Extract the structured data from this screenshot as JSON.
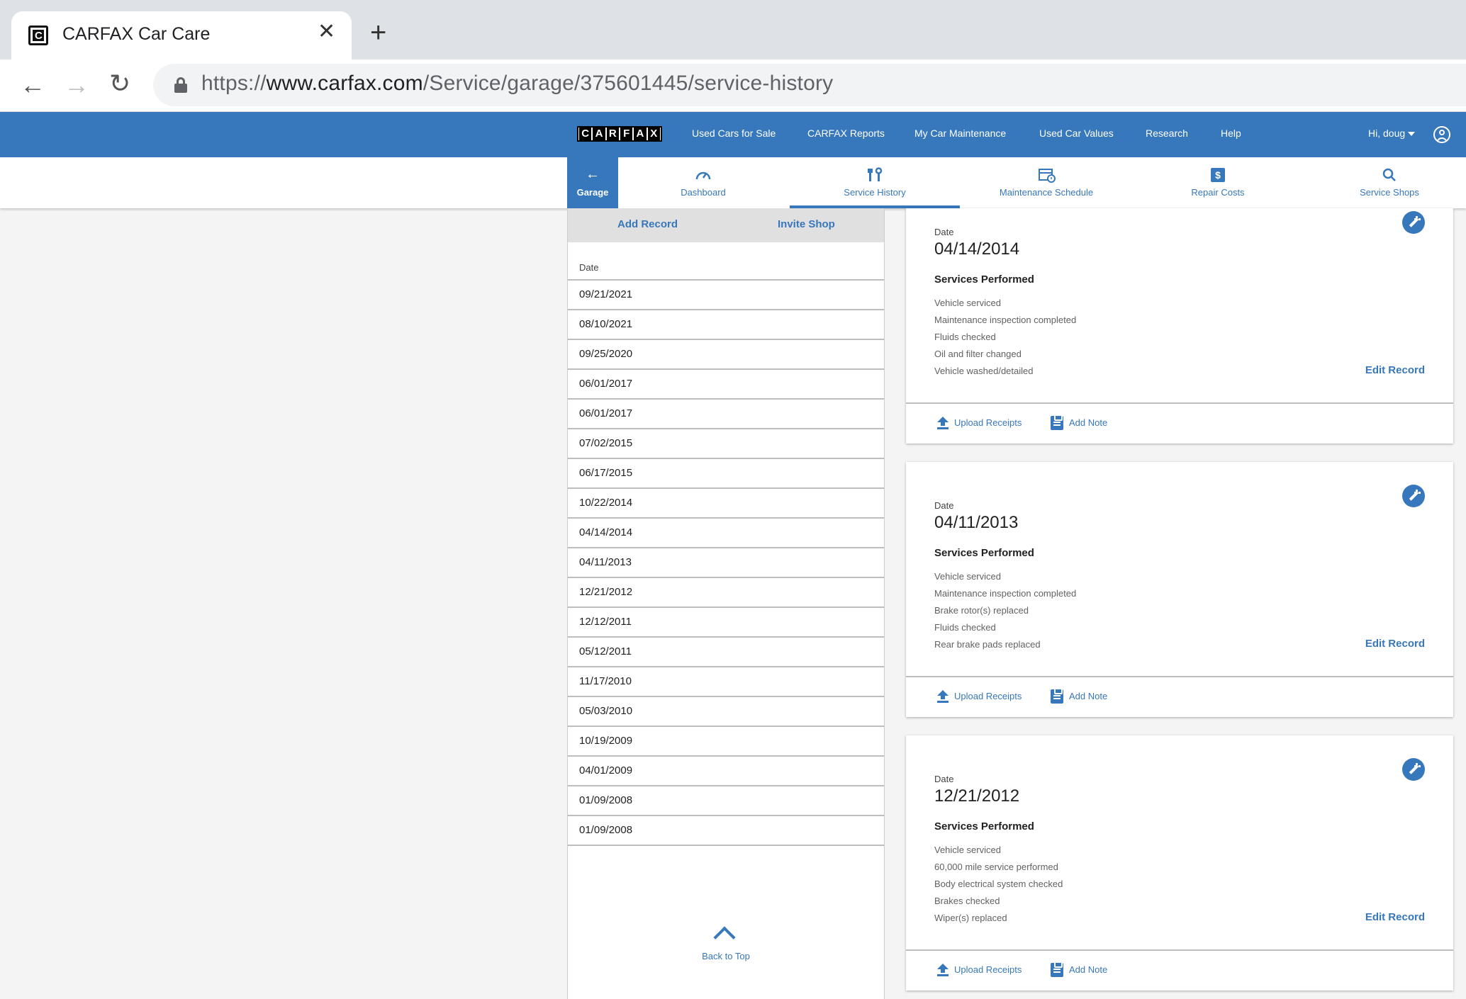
{
  "browser": {
    "tab_title": "CARFAX Car Care",
    "favicon_letter": "C",
    "url_prefix": "https://",
    "url_host": "www.carfax.com",
    "url_path": "/Service/garage/375601445/service-history"
  },
  "topnav": {
    "logo_letters": [
      "C",
      "A",
      "R",
      "F",
      "A",
      "X"
    ],
    "links": [
      "Used Cars for Sale",
      "CARFAX Reports",
      "My Car Maintenance",
      "Used Car Values",
      "Research",
      "Help"
    ],
    "user_greeting": "Hi, doug"
  },
  "subnav": {
    "back_label": "Garage",
    "tabs": [
      {
        "label": "Dashboard",
        "icon": "speedometer-icon"
      },
      {
        "label": "Service History",
        "icon": "wrench-icon",
        "active": true
      },
      {
        "label": "Maintenance Schedule",
        "icon": "calendar-icon"
      },
      {
        "label": "Repair Costs",
        "icon": "dollar-icon"
      },
      {
        "label": "Service Shops",
        "icon": "search-icon"
      }
    ]
  },
  "left_panel": {
    "add_record": "Add Record",
    "invite_shop": "Invite Shop",
    "date_header": "Date",
    "dates": [
      "09/21/2021",
      "08/10/2021",
      "09/25/2020",
      "06/01/2017",
      "06/01/2017",
      "07/02/2015",
      "06/17/2015",
      "10/22/2014",
      "04/14/2014",
      "04/11/2013",
      "12/21/2012",
      "12/12/2011",
      "05/12/2011",
      "11/17/2010",
      "05/03/2010",
      "10/19/2009",
      "04/01/2009",
      "01/09/2008",
      "01/09/2008"
    ],
    "back_to_top": "Back to Top"
  },
  "records": [
    {
      "date_label": "Date",
      "date": "04/14/2014",
      "services_title": "Services Performed",
      "services": [
        "Vehicle serviced",
        "Maintenance inspection completed",
        "Fluids checked",
        "Oil and filter changed",
        "Vehicle washed/detailed"
      ],
      "edit_label": "Edit Record",
      "upload_label": "Upload Receipts",
      "note_label": "Add Note"
    },
    {
      "date_label": "Date",
      "date": "04/11/2013",
      "services_title": "Services Performed",
      "services": [
        "Vehicle serviced",
        "Maintenance inspection completed",
        "Brake rotor(s) replaced",
        "Fluids checked",
        "Rear brake pads replaced"
      ],
      "edit_label": "Edit Record",
      "upload_label": "Upload Receipts",
      "note_label": "Add Note"
    },
    {
      "date_label": "Date",
      "date": "12/21/2012",
      "services_title": "Services Performed",
      "services": [
        "Vehicle serviced",
        "60,000 mile service performed",
        "Body electrical system checked",
        "Brakes checked",
        "Wiper(s) replaced"
      ],
      "edit_label": "Edit Record",
      "upload_label": "Upload Receipts",
      "note_label": "Add Note"
    }
  ],
  "colors": {
    "brand_blue": "#3777bc"
  }
}
